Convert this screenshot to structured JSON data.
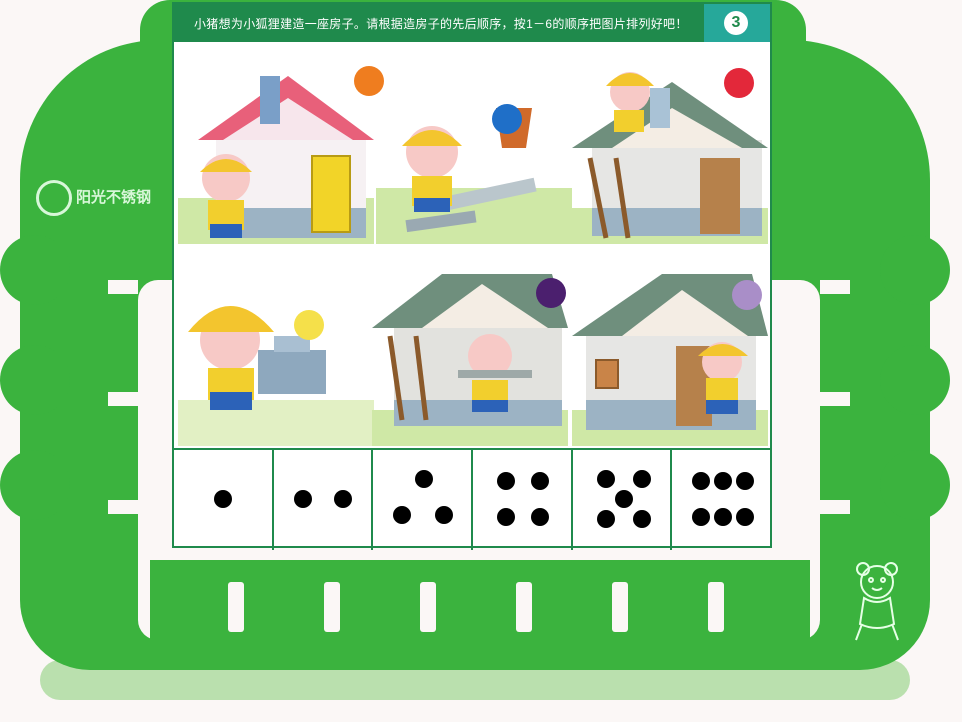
{
  "header": {
    "instruction": "小猪想为小狐狸建造一座房子。请根据造房子的先后顺序，按1－6的顺序把图片排列好吧！",
    "page_number": "3"
  },
  "brand": {
    "logo_text": "阳光不锈钢"
  },
  "panels": [
    {
      "name": "pig-painting-finished-house",
      "dot_color": "#ef7d1f"
    },
    {
      "name": "pig-gathering-materials",
      "dot_color": "#1f6fc8"
    },
    {
      "name": "pig-on-roof-building-chimney",
      "dot_color": "#e3283a"
    },
    {
      "name": "pig-stacking-bricks",
      "dot_color": "#f5e04a"
    },
    {
      "name": "pig-carrying-plank-into-house",
      "dot_color": "#4b1f6e"
    },
    {
      "name": "pig-opening-house-door",
      "dot_color": "#a98ec8"
    }
  ],
  "dice": [
    1,
    2,
    3,
    4,
    5,
    6
  ],
  "colors": {
    "board": "#3bb33e",
    "header": "#1f8a4c",
    "number_box": "#26a89a"
  }
}
